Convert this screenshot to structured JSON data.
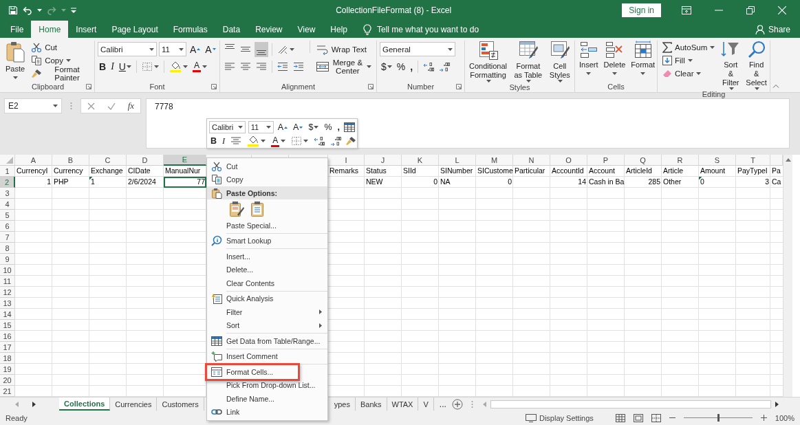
{
  "window": {
    "title": "CollectionFileFormat (8)  -  Excel",
    "sign_in": "Sign in"
  },
  "quick_access": [
    {
      "kind": "save",
      "disabled": false
    },
    {
      "kind": "undo",
      "disabled": false
    },
    {
      "kind": "redo",
      "disabled": true
    },
    {
      "kind": "customize",
      "disabled": false
    }
  ],
  "ribbon_tabs": [
    {
      "label": "File",
      "selected": false
    },
    {
      "label": "Home",
      "selected": true
    },
    {
      "label": "Insert",
      "selected": false
    },
    {
      "label": "Page Layout",
      "selected": false
    },
    {
      "label": "Formulas",
      "selected": false
    },
    {
      "label": "Data",
      "selected": false
    },
    {
      "label": "Review",
      "selected": false
    },
    {
      "label": "View",
      "selected": false
    },
    {
      "label": "Help",
      "selected": false
    }
  ],
  "tell_me": "Tell me what you want to do",
  "share": "Share",
  "ribbon_groups": [
    {
      "kind": "clipboard",
      "label": "Clipboard",
      "launcher": true,
      "paste": "Paste",
      "items": [
        {
          "label": "Cut",
          "dropdown": false
        },
        {
          "label": "Copy",
          "dropdown": true
        },
        {
          "label": "Format Painter",
          "dropdown": false
        }
      ]
    },
    {
      "kind": "font",
      "label": "Font",
      "launcher": true,
      "font_name": "Calibri",
      "font_size": "11",
      "grow": "A",
      "shrink": "A",
      "bold": "B",
      "italic": "I",
      "underline": "U",
      "font_color": "A"
    },
    {
      "kind": "alignment",
      "label": "Alignment",
      "launcher": true,
      "vertical_align": [
        {
          "selected": false
        },
        {
          "selected": false
        },
        {
          "selected": true
        }
      ],
      "horizontal_align": [
        {
          "selected": false
        },
        {
          "selected": false
        },
        {
          "selected": false
        }
      ],
      "wrap": "Wrap Text",
      "merge": "Merge & Center"
    },
    {
      "kind": "number",
      "label": "Number",
      "launcher": true,
      "format": "General",
      "currency": "$",
      "percent": "%",
      "comma": ","
    },
    {
      "kind": "styles",
      "label": "Styles",
      "launcher": false,
      "buttons": [
        "Conditional Formatting",
        "Format as Table",
        "Cell Styles"
      ]
    },
    {
      "kind": "cells",
      "label": "Cells",
      "launcher": false,
      "buttons": [
        "Insert",
        "Delete",
        "Format"
      ]
    },
    {
      "kind": "editing",
      "label": "Editing",
      "launcher": false,
      "small": [
        {
          "label": "AutoSum",
          "dropdown": true
        },
        {
          "label": "Fill",
          "dropdown": true
        },
        {
          "label": "Clear",
          "dropdown": true
        }
      ],
      "buttons": [
        "Sort & Filter",
        "Find & Select"
      ]
    }
  ],
  "formula_bar": {
    "name_box": "E2",
    "function_label": "fx",
    "value": "7778"
  },
  "mini_toolbar": {
    "font_name": "Calibri",
    "font_size": "11",
    "grow": "A",
    "shrink": "A",
    "currency": "$",
    "percent": "%",
    "comma": ",",
    "bold": "B",
    "italic": "I",
    "font_color": "A"
  },
  "sheet": {
    "columns": [
      {
        "label": "A",
        "selected": false
      },
      {
        "label": "B",
        "selected": false
      },
      {
        "label": "C",
        "selected": false
      },
      {
        "label": "D",
        "selected": false
      },
      {
        "label": "E",
        "selected": true
      },
      {
        "selected": false
      },
      {
        "selected": false
      },
      {
        "selected": false
      },
      {
        "label": "I",
        "selected": false
      },
      {
        "label": "J",
        "selected": false
      },
      {
        "label": "K",
        "selected": false
      },
      {
        "label": "L",
        "selected": false
      },
      {
        "label": "M",
        "selected": false
      },
      {
        "label": "N",
        "selected": false
      },
      {
        "label": "O",
        "selected": false
      },
      {
        "label": "P",
        "selected": false
      },
      {
        "label": "Q",
        "selected": false
      },
      {
        "label": "R",
        "selected": false
      },
      {
        "label": "S",
        "selected": false
      },
      {
        "label": "T",
        "selected": false
      },
      {
        "selected": false
      }
    ],
    "rows": [
      {
        "number": "1",
        "selected": false,
        "cells": [
          {
            "text": "CurrencyI",
            "selected": false
          },
          {
            "text": "Currency",
            "selected": false
          },
          {
            "text": "Exchange",
            "selected": false
          },
          {
            "text": "CIDate",
            "selected": false
          },
          {
            "text": "ManualNur",
            "selected": false
          },
          null,
          null,
          null,
          {
            "text": "Remarks",
            "selected": false
          },
          {
            "text": "Status",
            "selected": false
          },
          {
            "text": "SIId",
            "selected": false
          },
          {
            "text": "SINumber",
            "selected": false
          },
          {
            "text": "SICustome",
            "selected": false
          },
          {
            "text": "Particular",
            "selected": false
          },
          {
            "text": "AccountId",
            "selected": false
          },
          {
            "text": "Account",
            "selected": false
          },
          {
            "text": "ArticleId",
            "selected": false
          },
          {
            "text": "Article",
            "selected": false
          },
          {
            "text": "Amount",
            "selected": false
          },
          {
            "text": "PayTypeI",
            "selected": false
          },
          {
            "text": "Pa",
            "selected": false
          }
        ]
      },
      {
        "number": "2",
        "selected": true,
        "cells": [
          {
            "text": "1",
            "right_aligned": true,
            "selected": false
          },
          {
            "text": "PHP",
            "selected": false
          },
          {
            "text": "1",
            "flag": true,
            "selected": false
          },
          {
            "text": "2/6/2024",
            "selected": false
          },
          {
            "text": "77",
            "right_aligned": true,
            "selected": true
          },
          null,
          null,
          null,
          null,
          {
            "text": "NEW",
            "selected": false
          },
          {
            "text": "0",
            "right_aligned": true,
            "selected": false
          },
          {
            "text": "NA",
            "selected": false
          },
          {
            "text": "0",
            "right_aligned": true,
            "selected": false
          },
          null,
          {
            "text": "14",
            "right_aligned": true,
            "selected": false
          },
          {
            "text": "Cash in Ba",
            "selected": false
          },
          {
            "text": "285",
            "right_aligned": true,
            "selected": false
          },
          {
            "text": "Other",
            "selected": false
          },
          {
            "text": "0",
            "flag": true,
            "selected": false
          },
          {
            "text": "3",
            "right_aligned": true,
            "selected": false
          },
          {
            "text": "Ca",
            "selected": false
          }
        ]
      },
      {
        "number": "3",
        "selected": false
      },
      {
        "number": "4",
        "selected": false
      },
      {
        "number": "5",
        "selected": false
      },
      {
        "number": "6",
        "selected": false
      },
      {
        "number": "7",
        "selected": false
      },
      {
        "number": "8",
        "selected": false
      },
      {
        "number": "9",
        "selected": false
      },
      {
        "number": "10",
        "selected": false
      },
      {
        "number": "11",
        "selected": false
      },
      {
        "number": "12",
        "selected": false
      },
      {
        "number": "13",
        "selected": false
      },
      {
        "number": "14",
        "selected": false
      },
      {
        "number": "15",
        "selected": false
      },
      {
        "number": "16",
        "selected": false
      },
      {
        "number": "17",
        "selected": false
      },
      {
        "number": "18",
        "selected": false
      },
      {
        "number": "19",
        "selected": false
      },
      {
        "number": "20",
        "selected": false
      },
      {
        "number": "21",
        "selected": false
      }
    ]
  },
  "context_menu": [
    {
      "kind": "item",
      "label": "Cut",
      "submenu": false,
      "highlighted": false
    },
    {
      "kind": "item",
      "label": "Copy",
      "submenu": false,
      "highlighted": false
    },
    {
      "kind": "header",
      "label": "Paste Options:"
    },
    {
      "kind": "paste_icons"
    },
    {
      "kind": "item",
      "label": "Paste Special...",
      "submenu": false,
      "highlighted": false
    },
    {
      "kind": "separator"
    },
    {
      "kind": "item",
      "label": "Smart Lookup",
      "submenu": false,
      "highlighted": false
    },
    {
      "kind": "separator"
    },
    {
      "kind": "item",
      "label": "Insert...",
      "submenu": false,
      "highlighted": false
    },
    {
      "kind": "item",
      "label": "Delete...",
      "submenu": false,
      "highlighted": false
    },
    {
      "kind": "item",
      "label": "Clear Contents",
      "submenu": false,
      "highlighted": false
    },
    {
      "kind": "separator"
    },
    {
      "kind": "item",
      "label": "Quick Analysis",
      "submenu": false,
      "highlighted": false
    },
    {
      "kind": "item",
      "label": "Filter",
      "submenu": true,
      "highlighted": false
    },
    {
      "kind": "item",
      "label": "Sort",
      "submenu": true,
      "highlighted": false
    },
    {
      "kind": "separator"
    },
    {
      "kind": "item",
      "label": "Get Data from Table/Range...",
      "submenu": false,
      "highlighted": false
    },
    {
      "kind": "separator"
    },
    {
      "kind": "item",
      "label": "Insert Comment",
      "submenu": false,
      "highlighted": false
    },
    {
      "kind": "separator"
    },
    {
      "kind": "item",
      "label": "Format Cells...",
      "submenu": false,
      "highlighted": true
    },
    {
      "kind": "item",
      "label": "Pick From Drop-down List...",
      "submenu": false,
      "highlighted": false
    },
    {
      "kind": "item",
      "label": "Define Name...",
      "submenu": false,
      "highlighted": false
    },
    {
      "kind": "item",
      "label": "Link",
      "submenu": false,
      "highlighted": false
    }
  ],
  "sheet_tabs": [
    {
      "label": "Collections",
      "selected": true
    },
    {
      "label": "Currencies",
      "selected": false
    },
    {
      "label": "Customers",
      "selected": false
    },
    {
      "label": "ypes",
      "selected": false
    },
    {
      "label": "Banks",
      "selected": false
    },
    {
      "label": "WTAX",
      "selected": false
    },
    {
      "label": "V",
      "selected": false
    }
  ],
  "more_tabs": "...",
  "status_bar": {
    "mode": "Ready",
    "display_settings": "Display Settings",
    "zoom": {
      "level": 0.5,
      "reading": "100%"
    }
  }
}
